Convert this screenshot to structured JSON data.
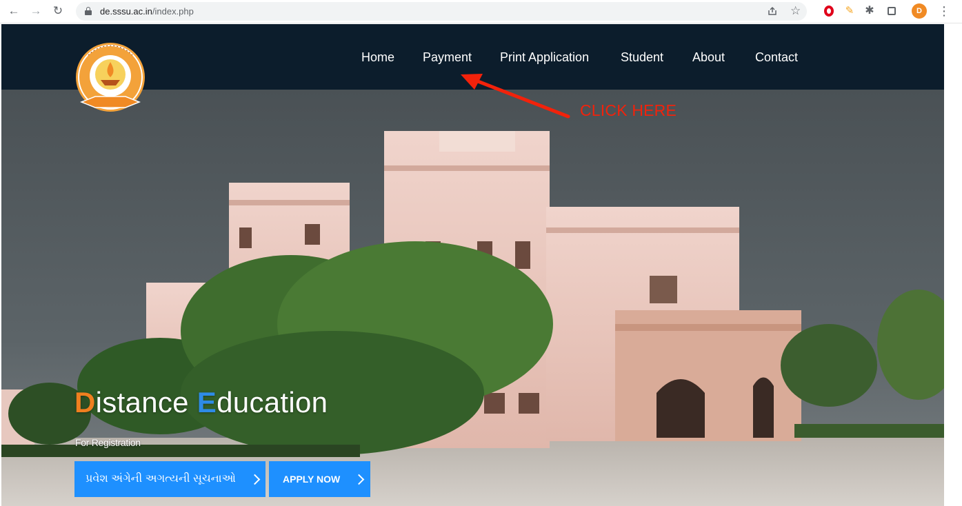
{
  "browser": {
    "url_domain": "de.sssu.ac.in",
    "url_path": "/index.php",
    "avatar_initial": "D"
  },
  "nav": {
    "items": [
      {
        "label": "Home"
      },
      {
        "label": "Payment"
      },
      {
        "label": "Print Application"
      },
      {
        "label": "Student"
      },
      {
        "label": "About"
      },
      {
        "label": "Contact"
      }
    ]
  },
  "annotation": {
    "label": "CLICK HERE",
    "color": "#f2220b"
  },
  "hero": {
    "title_first_letter": "D",
    "title_first_rest": "istance ",
    "title_second_letter": "E",
    "title_second_rest": "ducation",
    "caption": "For Registration",
    "buttons": {
      "notice_label": "પ્રવેશ અંગેની અગત્યની સૂચનાઓ",
      "apply_label": "APPLY NOW"
    }
  },
  "colors": {
    "header_bg": "#0c1d2c",
    "button_bg": "#1e90ff",
    "accent_orange": "#f07f1f",
    "accent_blue": "#2e8be6"
  },
  "icons": {
    "back": "arrow-left-icon",
    "forward": "arrow-right-icon",
    "reload": "reload-icon",
    "lock": "lock-icon",
    "share": "share-icon",
    "bookmark": "star-icon",
    "extension_opera": "opera-icon",
    "extension_brush": "brush-icon",
    "extensions": "puzzle-icon",
    "side_panel": "window-icon",
    "menu": "kebab-menu-icon"
  }
}
